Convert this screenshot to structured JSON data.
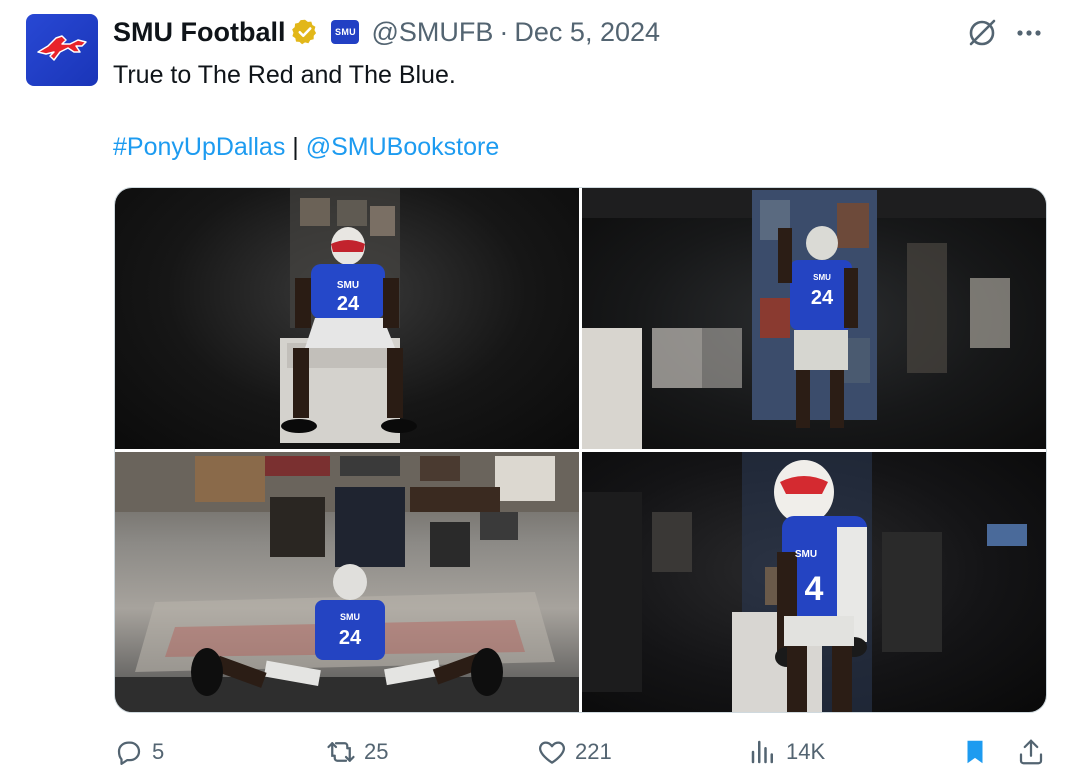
{
  "author": {
    "display_name": "SMU Football",
    "handle": "@SMUFB",
    "separator": "·",
    "date": "Dec 5, 2024",
    "affiliate_badge_text": "SMU",
    "avatar_icon": "mustang-logo-icon",
    "verified_color": "#e2b719"
  },
  "tweet": {
    "text": "True to The Red and The Blue.",
    "hashtag": "#PonyUpDallas",
    "divider": "|",
    "mention": "@SMUBookstore",
    "link_color": "#1d9bf0"
  },
  "media": {
    "photos": [
      {
        "name": "photo-1",
        "jersey_text": "SMU",
        "jersey_number": "24"
      },
      {
        "name": "photo-2",
        "jersey_text": "SMU",
        "jersey_number": "24"
      },
      {
        "name": "photo-3",
        "jersey_text": "SMU",
        "jersey_number": "24"
      },
      {
        "name": "photo-4",
        "jersey_text": "SMU",
        "jersey_number": "4"
      }
    ]
  },
  "actions": {
    "replies": "5",
    "reposts": "25",
    "likes": "221",
    "views": "14K",
    "bookmarked_color": "#1d9bf0"
  }
}
